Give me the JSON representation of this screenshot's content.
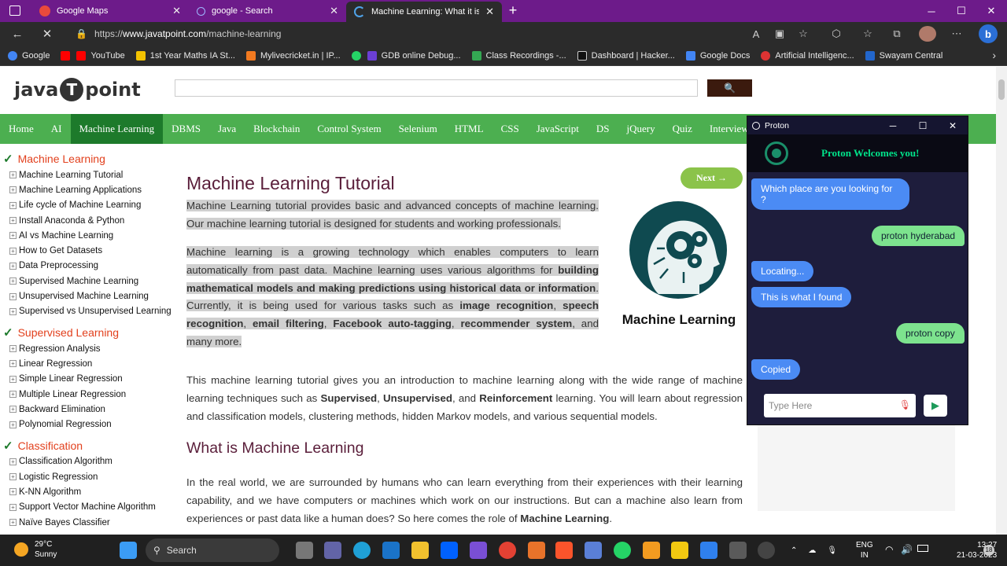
{
  "tabs": [
    {
      "label": "Google Maps",
      "icon": "maps-icon"
    },
    {
      "label": "google - Search",
      "icon": "search-icon"
    },
    {
      "label": "Machine Learning: What it is, Tut",
      "icon": "loading-icon",
      "active": true
    }
  ],
  "address": {
    "prefix": "https://",
    "host": "www.javatpoint.com",
    "path": "/machine-learning"
  },
  "bookmarks": [
    "Google",
    "",
    "YouTube",
    "1st Year Maths IA St...",
    "Mylivecricket.in | IP...",
    "",
    "GDB online Debug...",
    "Class Recordings -...",
    "Dashboard | Hacker...",
    "Google Docs",
    "Artificial Intelligenc...",
    "Swayam Central"
  ],
  "site": {
    "logo_left": "java",
    "logo_t": "T",
    "logo_right": "point",
    "search_icon": "🔍"
  },
  "topnav": [
    "Home",
    "AI",
    "Machine Learning",
    "DBMS",
    "Java",
    "Blockchain",
    "Control System",
    "Selenium",
    "HTML",
    "CSS",
    "JavaScript",
    "DS",
    "jQuery",
    "Quiz",
    "Interview Q"
  ],
  "sidebar": [
    {
      "section": "Machine Learning",
      "items": [
        "Machine Learning Tutorial",
        "Machine Learning Applications",
        "Life cycle of Machine Learning",
        "Install Anaconda & Python",
        "AI vs Machine Learning",
        "How to Get Datasets",
        "Data Preprocessing",
        "Supervised Machine Learning",
        "Unsupervised Machine Learning",
        "Supervised vs Unsupervised Learning"
      ]
    },
    {
      "section": "Supervised Learning",
      "items": [
        "Regression Analysis",
        "Linear Regression",
        "Simple Linear Regression",
        "Multiple Linear Regression",
        "Backward Elimination",
        "Polynomial Regression"
      ]
    },
    {
      "section": "Classification",
      "items": [
        "Classification Algorithm",
        "Logistic Regression",
        "K-NN Algorithm",
        "Support Vector Machine Algorithm",
        "Naïve Bayes Classifier"
      ]
    }
  ],
  "content": {
    "title": "Machine Learning Tutorial",
    "next_label": "Next →",
    "p1": "Machine Learning tutorial provides basic and advanced concepts of machine learning. Our machine learning tutorial is designed for students and working professionals.",
    "p2_a": "Machine learning is a growing technology which enables computers to learn automatically from past data. Machine learning uses various algorithms for ",
    "p2_b": "building mathematical models and making predictions using historical data or information",
    "p2_c": ". Currently, it is being used for various tasks such as ",
    "p2_d": "image recognition",
    "p2_e": ", ",
    "p2_f": "speech recognition",
    "p2_g": ", ",
    "p2_h": "email filtering",
    "p2_i": ", ",
    "p2_j": "Facebook auto-tagging",
    "p2_k": ", ",
    "p2_l": "recommender system",
    "p2_m": ", and many more.",
    "p3_a": "This machine learning tutorial gives you an introduction to machine learning along with the wide range of machine learning techniques such as ",
    "p3_b": "Supervised",
    "p3_c": ", ",
    "p3_d": "Unsupervised",
    "p3_e": ", and ",
    "p3_f": "Reinforcement",
    "p3_g": " learning. You will learn about regression and classification models, clustering methods, hidden Markov models, and various sequential models.",
    "image_caption": "Machine Learning",
    "h2": "What is Machine Learning",
    "p4_a": "In the real world, we are surrounded by humans who can learn everything from their experiences with their learning capability, and we have computers or machines which work on our instructions. But can a machine also learn from experiences or past data like a human does? So here comes the role of ",
    "p4_b": "Machine Learning",
    "p4_c": "."
  },
  "proton": {
    "window_title": "Proton",
    "welcome": "Proton Welcomes you!",
    "messages": [
      {
        "from": "bot",
        "text": "Which place are you looking for ?"
      },
      {
        "from": "user",
        "text": "proton hyderabad"
      },
      {
        "from": "bot",
        "text": "Locating..."
      },
      {
        "from": "bot",
        "text": "This is what I found"
      },
      {
        "from": "user",
        "text": "proton copy"
      },
      {
        "from": "bot",
        "text": "Copied"
      }
    ],
    "input_placeholder": "Type Here"
  },
  "taskbar": {
    "temp": "29°C",
    "condition": "Sunny",
    "search": "Search",
    "lang1": "ENG",
    "lang2": "IN",
    "time": "13:27",
    "date": "21-03-2023",
    "badge": "18"
  },
  "colors": {
    "nav_green": "#4caf50",
    "nav_active": "#1d7a2b",
    "tab_purple": "#6d1b8a",
    "section_red": "#e2401d"
  }
}
